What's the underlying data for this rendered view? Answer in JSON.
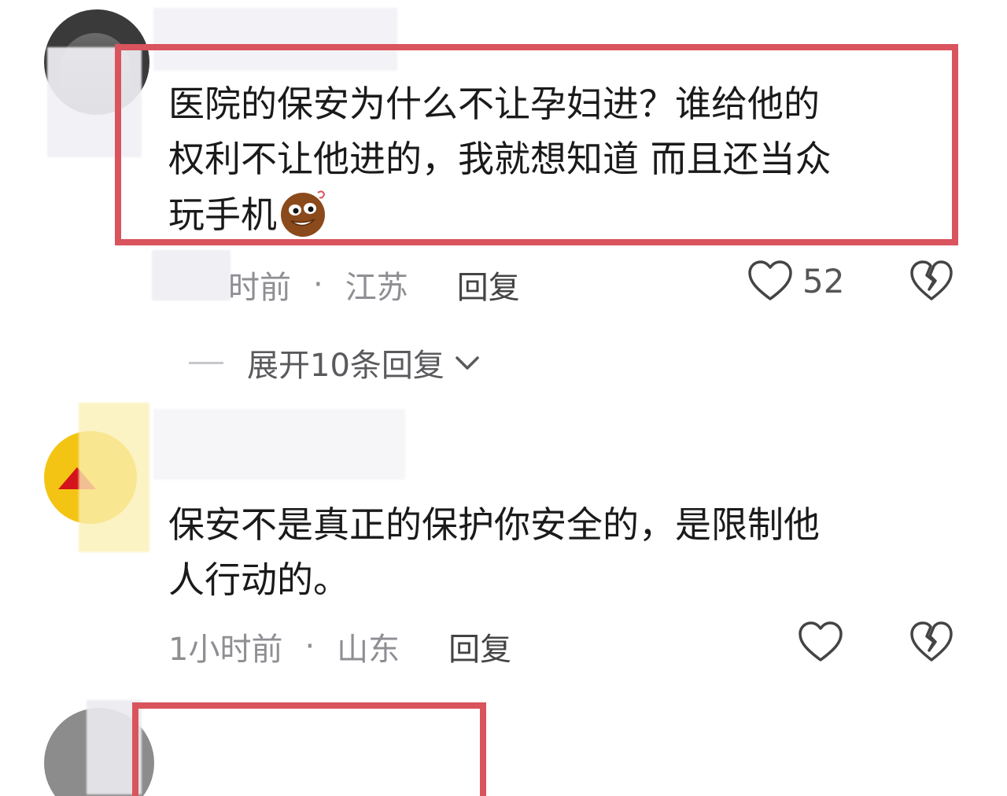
{
  "comments": [
    {
      "text_line1": "医院的保安为什么不让孕妇进？谁给他的",
      "text_line2": "权利不让他进的，我就想知道 而且还当众",
      "text_line3": "玩手机",
      "emoji": "sweating-face-emoji",
      "time": "时前",
      "location": "江苏",
      "reply_label": "回复",
      "likes": "52",
      "highlight_color": "#d9545d"
    },
    {
      "text_line1": "保安不是真正的保护你安全的，是限制他",
      "text_line2": "人行动的。",
      "time": "1小时前",
      "location": "山东",
      "reply_label": "回复",
      "likes": ""
    }
  ],
  "expand_replies_label": "展开10条回复",
  "meta_separator": "·",
  "icons": [
    "heart-icon",
    "broken-heart-icon",
    "chevron-down-icon"
  ],
  "colors": {
    "text": "#1a1a1a",
    "meta": "#8e8e93",
    "highlight": "#d9545d"
  }
}
